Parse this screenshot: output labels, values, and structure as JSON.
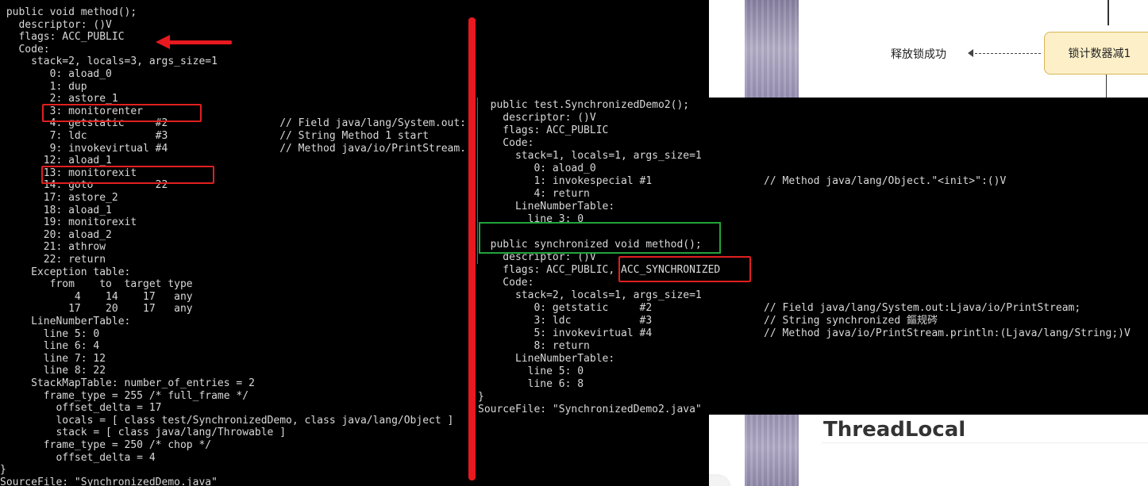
{
  "left_terminal": {
    "lines": [
      " public void method();",
      "   descriptor: ()V",
      "   flags: ACC_PUBLIC",
      "   Code:",
      "     stack=2, locals=3, args_size=1",
      "        0: aload_0",
      "        1: dup",
      "        2: astore_1",
      "        3: monitorenter",
      "        4: getstatic     #2                  // Field java/lang/System.out:",
      "        7: ldc           #3                  // String Method 1 start",
      "        9: invokevirtual #4                  // Method java/io/PrintStream.",
      "       12: aload_1",
      "       13: monitorexit",
      "       14: goto          22",
      "       17: astore_2",
      "       18: aload_1",
      "       19: monitorexit",
      "       20: aload_2",
      "       21: athrow",
      "       22: return",
      "     Exception table:",
      "        from    to  target type",
      "            4    14    17   any",
      "           17    20    17   any",
      "     LineNumberTable:",
      "       line 5: 0",
      "       line 6: 4",
      "       line 7: 12",
      "       line 8: 22",
      "     StackMapTable: number_of_entries = 2",
      "       frame_type = 255 /* full_frame */",
      "         offset_delta = 17",
      "         locals = [ class test/SynchronizedDemo, class java/lang/Object ]",
      "         stack = [ class java/lang/Throwable ]",
      "       frame_type = 250 /* chop */",
      "         offset_delta = 4",
      "}",
      "SourceFile: \"SynchronizedDemo.java\""
    ]
  },
  "right_terminal": {
    "lines": [
      "  public test.SynchronizedDemo2();",
      "    descriptor: ()V",
      "    flags: ACC_PUBLIC",
      "    Code:",
      "      stack=1, locals=1, args_size=1",
      "         0: aload_0",
      "         1: invokespecial #1                  // Method java/lang/Object.\"<init>\":()V",
      "         4: return",
      "      LineNumberTable:",
      "        line 3: 0",
      "",
      "  public synchronized void method();",
      "    descriptor: ()V",
      "    flags: ACC_PUBLIC, ACC_SYNCHRONIZED",
      "    Code:",
      "      stack=2, locals=1, args_size=1",
      "         0: getstatic     #2                  // Field java/lang/System.out:Ljava/io/PrintStream;",
      "         3: ldc           #3                  // String synchronized 鏂规硶",
      "         5: invokevirtual #4                  // Method java/io/PrintStream.println:(Ljava/lang/String;)V",
      "         8: return",
      "      LineNumberTable:",
      "        line 5: 0",
      "        line 6: 8",
      "}",
      "SourceFile: \"SynchronizedDemo2.java\""
    ]
  },
  "web_page": {
    "flow_box_label": "锁计数器减1",
    "release_label": "释放锁成功",
    "heading": "ThreadLocal"
  },
  "colors": {
    "terminal_bg": "#000000",
    "terminal_text": "#d9d9d9",
    "annotation_red": "#e8191f",
    "annotation_green": "#22a43a"
  }
}
